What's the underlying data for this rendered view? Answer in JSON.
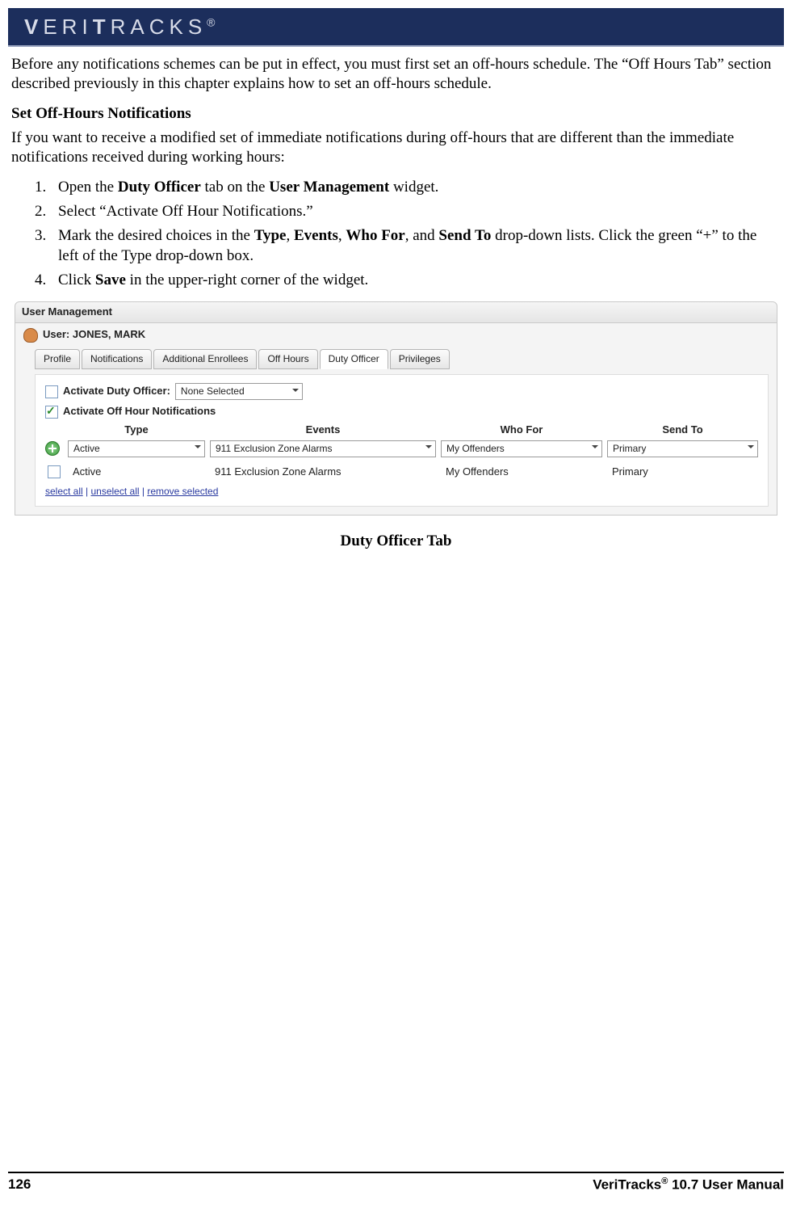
{
  "brand": "VERITRACKS",
  "brand_mark": "®",
  "intro": "Before any notifications schemes can be put in effect, you must first set an off-hours schedule. The “Off Hours Tab” section described previously in this chapter explains how to set an off-hours schedule.",
  "heading": "Set Off-Hours Notifications",
  "desc": "If you want to receive a modified set of immediate notifications during off-hours that are different than the immediate notifications received during working hours:",
  "steps": {
    "s1a": "Open the ",
    "s1b": "Duty Officer",
    "s1c": " tab on the ",
    "s1d": "User Management",
    "s1e": " widget.",
    "s2": "Select “Activate Off Hour Notifications.”",
    "s3a": "Mark the desired choices in the ",
    "s3b": "Type",
    "s3c": ", ",
    "s3d": "Events",
    "s3e": ", ",
    "s3f": "Who For",
    "s3g": ", and ",
    "s3h": "Send To",
    "s3i": " drop-down lists. Click the green “+” to the left of the Type drop-down box.",
    "s4a": "Click ",
    "s4b": "Save",
    "s4c": " in the upper-right corner of the widget."
  },
  "widget": {
    "title": "User Management",
    "user_label": "User: JONES, MARK",
    "tabs": [
      "Profile",
      "Notifications",
      "Additional Enrollees",
      "Off Hours",
      "Duty Officer",
      "Privileges"
    ],
    "selected_tab": 4,
    "activate_duty_label": "Activate Duty Officer:",
    "activate_duty_select": "None Selected",
    "activate_offhr_label": "Activate Off Hour Notifications",
    "headers": [
      "Type",
      "Events",
      "Who For",
      "Send To"
    ],
    "row_selects": {
      "type": "Active",
      "events": "911 Exclusion Zone Alarms",
      "whofor": "My Offenders",
      "sendto": "Primary"
    },
    "row_static": {
      "type": "Active",
      "events": "911 Exclusion Zone Alarms",
      "whofor": "My Offenders",
      "sendto": "Primary"
    },
    "links": {
      "select_all": "select all",
      "unselect_all": "unselect all",
      "remove_selected": "remove selected"
    }
  },
  "caption": "Duty Officer Tab",
  "footer": {
    "page": "126",
    "manual_a": "VeriTracks",
    "manual_b": "®",
    "manual_c": " 10.7 User Manual"
  }
}
